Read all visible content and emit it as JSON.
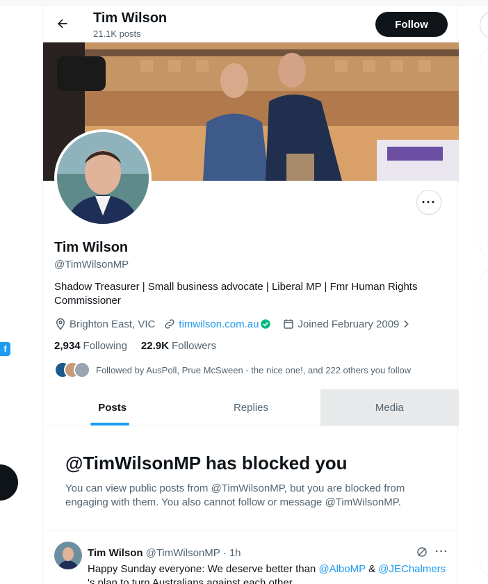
{
  "header": {
    "title": "Tim Wilson",
    "post_count": "21.1K posts",
    "follow_label": "Follow"
  },
  "profile": {
    "name": "Tim Wilson",
    "handle": "@TimWilsonMP",
    "bio": "Shadow Treasurer | Small business advocate | Liberal MP | Fmr Human Rights Commissioner",
    "location": "Brighton East, VIC",
    "website": "timwilson.com.au",
    "joined": "Joined February 2009",
    "following_count": "2,934",
    "following_label": "Following",
    "followers_count": "22.9K",
    "followers_label": "Followers",
    "followed_by": "Followed by AusPoll, Prue McSween - the nice one!, and 222 others you follow"
  },
  "tabs": [
    {
      "label": "Posts"
    },
    {
      "label": "Replies"
    },
    {
      "label": "Media"
    }
  ],
  "blocked": {
    "title": "@TimWilsonMP has blocked you",
    "message": "You can view public posts from @TimWilsonMP, but you are blocked from engaging with them. You also cannot follow or message @TimWilsonMP."
  },
  "tweet": {
    "name": "Tim Wilson",
    "handle_time": "@TimWilsonMP · 1h",
    "text_before": "Happy Sunday everyone: We deserve better than ",
    "mention1": "@AlboMP",
    "text_mid": " & ",
    "mention2": "@JEChalmers",
    "text_after": " 's plan to turn Australians against each other."
  },
  "left_rail": {
    "badge": "f"
  },
  "icons": [
    "back-arrow-icon",
    "more-icon",
    "location-icon",
    "link-icon",
    "verified-icon",
    "calendar-icon",
    "chevron-right-icon",
    "grok-icon"
  ],
  "colors": {
    "accent": "#1d9bf0",
    "text": "#0f1419",
    "muted": "#536471",
    "verified": "#00ba7c"
  }
}
